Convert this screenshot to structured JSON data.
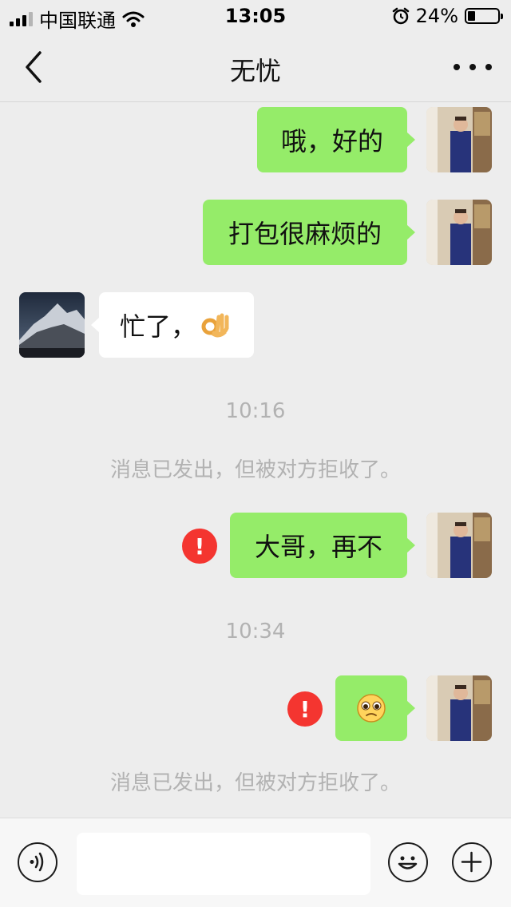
{
  "status_bar": {
    "carrier": "中国联通",
    "time": "13:05",
    "battery": "24%"
  },
  "nav": {
    "title": "无忧"
  },
  "messages": [
    {
      "from": "me",
      "text": "哦，好的"
    },
    {
      "from": "me",
      "text": "打包很麻烦的"
    },
    {
      "from": "them",
      "text": "忙了，",
      "emoji": "ok-hand"
    },
    {
      "type": "system",
      "text": "10:16"
    },
    {
      "type": "system",
      "text": "消息已发出，但被对方拒收了。"
    },
    {
      "from": "me",
      "text": "大哥，再不",
      "failed": true
    },
    {
      "type": "system",
      "text": "10:34"
    },
    {
      "from": "me",
      "emoji": "pleading-face",
      "failed": true
    },
    {
      "type": "system",
      "text": "消息已发出，但被对方拒收了。"
    }
  ],
  "error_mark": "!",
  "input_bar": {
    "placeholder": "",
    "icons": [
      "voice-icon",
      "emoji-icon",
      "plus-icon"
    ]
  },
  "colors": {
    "my_bubble": "#95ec69",
    "their_bubble": "#ffffff",
    "background": "#ededed",
    "error_badge": "#f43530"
  }
}
